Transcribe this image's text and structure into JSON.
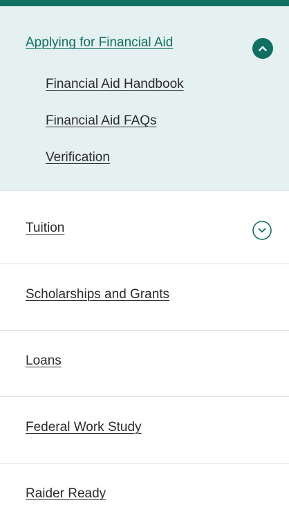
{
  "nav": {
    "open_section": {
      "label": "Applying for Financial Aid",
      "toggle_icon": "chevron-up-icon",
      "children": [
        "Financial Aid Handbook",
        "Financial Aid FAQs",
        "Verification"
      ]
    },
    "items": [
      {
        "label": "Tuition",
        "toggle_icon": "chevron-down-icon"
      },
      {
        "label": "Scholarships and Grants"
      },
      {
        "label": "Loans"
      },
      {
        "label": "Federal Work Study"
      },
      {
        "label": "Raider Ready"
      }
    ]
  },
  "colors": {
    "accent": "#0f6f61",
    "open_background": "#e5f0f1",
    "text": "#2b2b2b",
    "divider": "#dcdcdc"
  }
}
